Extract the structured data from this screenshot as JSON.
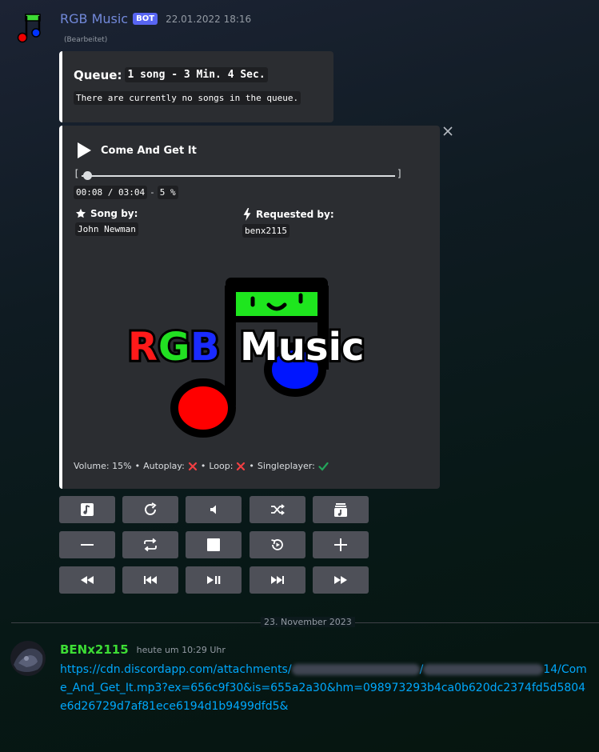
{
  "bot_message": {
    "username": "RGB Music",
    "tag": "BOT",
    "timestamp": "22.01.2022 18:16",
    "edited": "(Bearbeitet)",
    "queue_embed": {
      "title_label": "Queue:",
      "title_code": "1 song - 3 Min. 4 Sec.",
      "description": "There are currently no songs in the queue."
    },
    "now_playing_embed": {
      "song_title": "Come And Get It",
      "bracket_left": "[",
      "bracket_right": "]",
      "progress_fraction": 0.05,
      "time_display": "00:08 / 03:04",
      "dash": "-",
      "percent": "5 %",
      "song_by_label": "Song by:",
      "song_by_value": "John Newman",
      "requested_by_label": "Requested by:",
      "requested_by_value": "benx2115",
      "logo_text_r": "R",
      "logo_text_g": "G",
      "logo_text_b": "B",
      "logo_text_music": "Music",
      "footer_volume": "Volume: 15%",
      "footer_autoplay": "Autoplay:",
      "footer_loop": "Loop:",
      "footer_singleplayer": "Singleplayer:",
      "bullet": "•"
    },
    "close_icon": "close-icon",
    "buttons": [
      [
        "queue-icon",
        "refresh-icon",
        "volume-icon",
        "shuffle-icon",
        "playlist-icon"
      ],
      [
        "minus-icon",
        "repeat-icon",
        "stop-icon",
        "replay-icon",
        "plus-icon"
      ],
      [
        "rewind-icon",
        "previous-icon",
        "play-pause-icon",
        "next-icon",
        "fast-forward-icon"
      ]
    ]
  },
  "date_divider": "23. November 2023",
  "user_message": {
    "username": "BENx2115",
    "timestamp": "heute um 10:29 Uhr",
    "link_part1": "https://cdn.discordapp.com/attachments/",
    "link_part2": "/",
    "link_part3": "14/Come_And_Get_It.mp3?ex=656c9f30&is=655a2a30&hm=098973293b4ca0b620dc2374fd5d5804e6d26729d7af81ece6194d1b9499dfd5&"
  },
  "colors": {
    "bot_name": "#7289da",
    "user_name": "#3ddc35",
    "link": "#00a8fc",
    "embed_bg": "#2b2d31",
    "button_bg": "#4e5058",
    "red_x": "#f23f43",
    "green_check": "#23a55a"
  }
}
